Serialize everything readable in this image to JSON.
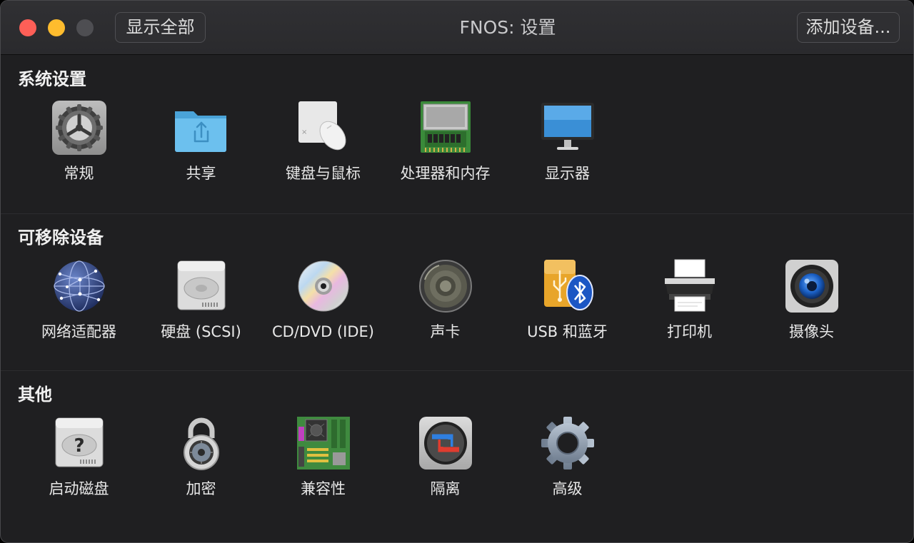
{
  "window": {
    "title": "FNOS: 设置",
    "show_all_label": "显示全部",
    "add_device_label": "添加设备..."
  },
  "sections": [
    {
      "title": "系统设置",
      "items": [
        {
          "label": "常规",
          "icon": "gear-icon"
        },
        {
          "label": "共享",
          "icon": "shared-folder-icon"
        },
        {
          "label": "键盘与鼠标",
          "icon": "keyboard-mouse-icon"
        },
        {
          "label": "处理器和内存",
          "icon": "memory-chip-icon"
        },
        {
          "label": "显示器",
          "icon": "display-icon"
        }
      ]
    },
    {
      "title": "可移除设备",
      "items": [
        {
          "label": "网络适配器",
          "icon": "network-globe-icon"
        },
        {
          "label": "硬盘 (SCSI)",
          "icon": "hard-disk-icon"
        },
        {
          "label": "CD/DVD (IDE)",
          "icon": "cd-dvd-icon"
        },
        {
          "label": "声卡",
          "icon": "speaker-icon"
        },
        {
          "label": "USB 和蓝牙",
          "icon": "usb-bluetooth-icon"
        },
        {
          "label": "打印机",
          "icon": "printer-icon"
        },
        {
          "label": "摄像头",
          "icon": "camera-icon"
        }
      ]
    },
    {
      "title": "其他",
      "items": [
        {
          "label": "启动磁盘",
          "icon": "startup-disk-icon"
        },
        {
          "label": "加密",
          "icon": "padlock-icon"
        },
        {
          "label": "兼容性",
          "icon": "motherboard-icon"
        },
        {
          "label": "隔离",
          "icon": "isolation-icon"
        },
        {
          "label": "高级",
          "icon": "advanced-gear-icon"
        }
      ]
    }
  ],
  "colors": {
    "window_bg": "#1f1f21",
    "titlebar": "#2c2c2f",
    "close": "#fe5f57",
    "minimize": "#febc2e",
    "zoom_disabled": "#4e4e52"
  }
}
